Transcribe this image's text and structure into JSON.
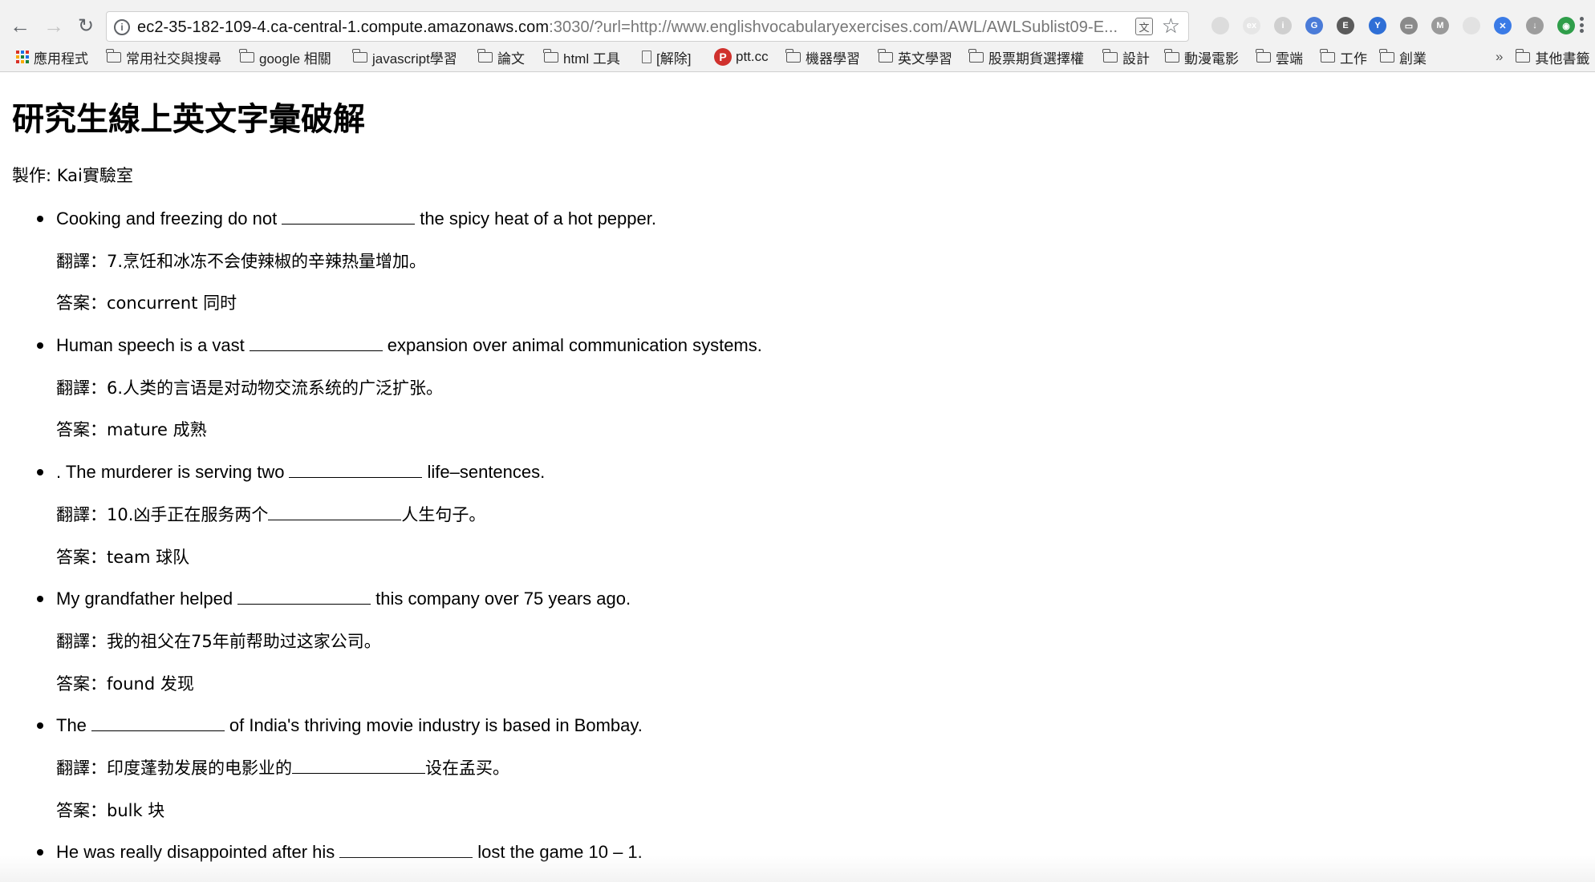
{
  "browser": {
    "url_host": "ec2-35-182-109-4.ca-central-1.compute.amazonaws.com",
    "url_rest": ":3030/?url=http://www.englishvocabularyexercises.com/AWL/AWLSublist09-E...",
    "translate_glyph": "文",
    "info_glyph": "i",
    "nav": {
      "back": "←",
      "forward": "→",
      "reload": "↻"
    },
    "extensions": [
      {
        "icon": "cog-extension-icon",
        "glyph": "",
        "color": "#dcdcdc"
      },
      {
        "icon": "ex-extension-icon",
        "glyph": "ex",
        "color": "#e6e6e6"
      },
      {
        "icon": "circle-extension-icon",
        "glyph": "i",
        "color": "#cfcfcf"
      },
      {
        "icon": "translate-extension-icon",
        "glyph": "G",
        "color": "#4a7bd8"
      },
      {
        "icon": "evernote-icon",
        "glyph": "E",
        "color": "#5b5b5b"
      },
      {
        "icon": "y-extension-icon",
        "glyph": "Y",
        "color": "#2f6fd6"
      },
      {
        "icon": "cast-icon",
        "glyph": "▭",
        "color": "#8a8a8a"
      },
      {
        "icon": "m-extension-icon",
        "glyph": "M",
        "color": "#9a9a9a"
      },
      {
        "icon": "moon-extension-icon",
        "glyph": "",
        "color": "#e2e2e2"
      },
      {
        "icon": "adblock-icon",
        "glyph": "✕",
        "color": "#3b7be6"
      },
      {
        "icon": "download-icon",
        "glyph": "↓",
        "color": "#9d9d9d"
      },
      {
        "icon": "feedly-icon",
        "glyph": "◉",
        "color": "#2f9e4a"
      }
    ],
    "bookmarks": [
      {
        "label": "應用程式",
        "icon": "apps"
      },
      {
        "label": "常用社交與搜尋",
        "icon": "folder"
      },
      {
        "label": "google 相關",
        "icon": "folder"
      },
      {
        "label": "javascript學習",
        "icon": "folder"
      },
      {
        "label": "論文",
        "icon": "folder"
      },
      {
        "label": "html 工具",
        "icon": "folder"
      },
      {
        "label": "[解除]",
        "icon": "page"
      },
      {
        "label": "ptt.cc",
        "icon": "ptt"
      },
      {
        "label": "機器學習",
        "icon": "folder"
      },
      {
        "label": "英文學習",
        "icon": "folder"
      },
      {
        "label": "股票期貨選擇權",
        "icon": "folder"
      },
      {
        "label": "設計",
        "icon": "folder"
      },
      {
        "label": "動漫電影",
        "icon": "folder"
      },
      {
        "label": "雲端",
        "icon": "folder"
      },
      {
        "label": "工作",
        "icon": "folder"
      },
      {
        "label": "創業",
        "icon": "folder"
      }
    ],
    "more_bookmarks": "»",
    "other_bookmarks": "其他書籤"
  },
  "page": {
    "title": "研究生線上英文字彙破解",
    "author": "製作: Kai實驗室",
    "items": [
      {
        "q_pre": "Cooking and freezing do not",
        "q_post": "the spicy heat of a hot pepper.",
        "tr_pre": "翻譯：7.烹饪和冰冻不会使辣椒的辛辣热量增加。",
        "tr_post": "",
        "tr_blank": false,
        "answer": "答案：concurrent 同时"
      },
      {
        "q_pre": "Human speech is a vast",
        "q_post": "expansion over animal communication systems.",
        "tr_pre": "翻譯：6.人类的言语是对动物交流系统的广泛扩张。",
        "tr_post": "",
        "tr_blank": false,
        "answer": "答案：mature 成熟"
      },
      {
        "q_pre": ". The murderer is serving two",
        "q_post": "life–sentences.",
        "tr_pre": "翻譯：10.凶手正在服务两个",
        "tr_post": "人生句子。",
        "tr_blank": true,
        "answer": "答案：team 球队"
      },
      {
        "q_pre": "My grandfather helped",
        "q_post": "this company over 75 years ago.",
        "tr_pre": "翻譯：我的祖父在75年前帮助过这家公司。",
        "tr_post": "",
        "tr_blank": false,
        "answer": "答案：found 发现"
      },
      {
        "q_pre": "The",
        "q_post": "of India's thriving movie industry is based in Bombay.",
        "tr_pre": "翻譯：印度蓬勃发展的电影业的",
        "tr_post": "设在孟买。",
        "tr_blank": true,
        "answer": "答案：bulk 块"
      },
      {
        "q_pre": "He was really disappointed after his",
        "q_post": "lost the game 10 – 1.",
        "tr_pre": "",
        "tr_post": "",
        "tr_blank": false,
        "answer": ""
      }
    ]
  }
}
